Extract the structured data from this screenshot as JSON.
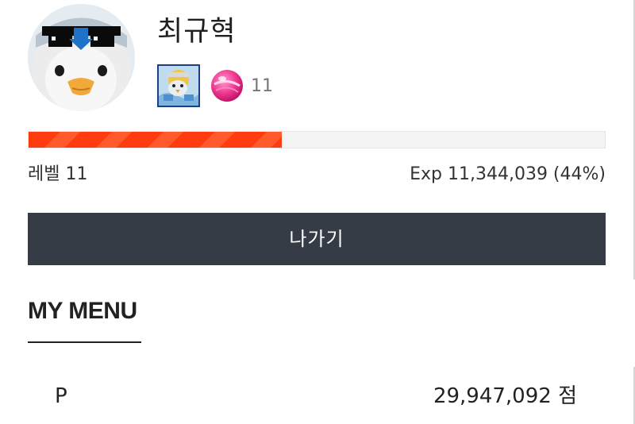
{
  "profile": {
    "username": "최규혁",
    "avatar_icon": "penguin-avatar-icon",
    "badge_icon": "penguin-badge-icon",
    "candy_icon": "pink-candy-icon",
    "candy_count": "11"
  },
  "level": {
    "label": "레벨 11",
    "exp_text": "Exp 11,344,039 (44%)",
    "progress_fraction": 0.44,
    "progress_color": "#ff3b10"
  },
  "actions": {
    "leave_label": "나가기",
    "button_color": "#353c46"
  },
  "menu": {
    "heading": "MY MENU",
    "items": [
      {
        "key": "P",
        "value": "29,947,092 점"
      }
    ]
  }
}
